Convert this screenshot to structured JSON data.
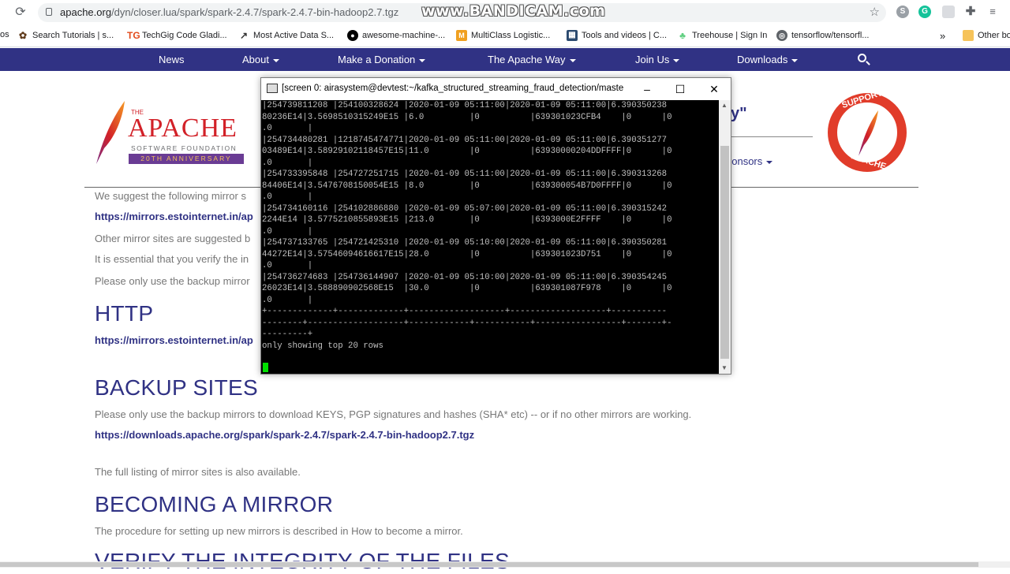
{
  "browser": {
    "url_host": "apache.org",
    "url_path": "/dyn/closer.lua/spark/spark-2.4.7/spark-2.4.7-bin-hadoop2.7.tgz",
    "watermark": "www.BANDICAM.com"
  },
  "bookmarks": {
    "items": [
      {
        "label": "os"
      },
      {
        "label": "Search Tutorials | s..."
      },
      {
        "label": "TechGig Code Gladi..."
      },
      {
        "label": "Most Active Data S..."
      },
      {
        "label": "awesome-machine-..."
      },
      {
        "label": "MultiClass Logistic..."
      },
      {
        "label": "Tools and videos | C..."
      },
      {
        "label": "Treehouse | Sign In"
      },
      {
        "label": "tensorflow/tensorfl..."
      },
      {
        "label": "Other bo"
      }
    ],
    "more": "»"
  },
  "apache_nav": {
    "items": [
      "News",
      "About",
      "Make a Donation",
      "The Apache Way",
      "Join Us",
      "Downloads"
    ]
  },
  "logo": {
    "the": "THE",
    "name": "APACHE",
    "foundation": "SOFTWARE FOUNDATION",
    "anniversary": "20TH ANNIVERSARY",
    "support_top": "SUPPORT",
    "support_bottom": "APACHE"
  },
  "page": {
    "quote_fragment": "y\"",
    "sponsors": "ponsors",
    "suggest": "We suggest the following mirror s",
    "mirror_link": "https://mirrors.estointernet.in/ap",
    "other_mirrors": "Other mirror sites are suggested b",
    "essential": "It is essential that you verify the in",
    "backup_only": "Please only use the backup mirror",
    "http_heading": "HTTP",
    "http_link": "https://mirrors.estointernet.in/ap",
    "backup_heading": "BACKUP SITES",
    "backup_text": "Please only use the backup mirrors to download KEYS, PGP signatures and hashes (SHA* etc) -- or if no other mirrors are working.",
    "backup_link": "https://downloads.apache.org/spark/spark-2.4.7/spark-2.4.7-bin-hadoop2.7.tgz",
    "full_listing_1": "The full listing of mirror sites",
    "full_listing_2": " is also available.",
    "mirror_heading": "BECOMING A MIRROR",
    "mirror_text_1": "The procedure for setting up new mirrors is described in ",
    "mirror_text_2": "How to become a mirror",
    "mirror_text_3": ".",
    "verify_heading": "VERIFY THE INTEGRITY OF THE FILES"
  },
  "terminal": {
    "title": "[screen 0: airasystem@devtest:~/kafka_structured_streaming_fraud_detection/maste",
    "lines": [
      "|254739811208 |254100328624 |2020-01-09 05:11:00|2020-01-09 05:11:00|6.390350238",
      "80236E14|3.5698510315249E15 |6.0         |0          |639301023CFB4    |0      |0",
      ".0       |",
      "|254734480281 |1218745474771|2020-01-09 05:11:00|2020-01-09 05:11:00|6.390351277",
      "03489E14|3.58929102118457E15|11.0        |0          |63930000204DDFFFF|0      |0",
      ".0       |",
      "|254733395848 |254727251715 |2020-01-09 05:11:00|2020-01-09 05:11:00|6.390313268",
      "84406E14|3.5476708150054E15 |8.0         |0          |639300054B7D0FFFF|0      |0",
      ".0       |",
      "|254734160116 |254102886880 |2020-01-09 05:07:00|2020-01-09 05:11:00|6.390315242",
      "2244E14 |3.5775210855893E15 |213.0       |0          |6393000E2FFFF    |0      |0",
      ".0       |",
      "|254737133765 |254721425310 |2020-01-09 05:10:00|2020-01-09 05:11:00|6.390350281",
      "44272E14|3.57546094616617E15|28.0        |0          |639301023D751    |0      |0",
      ".0       |",
      "|254736274683 |254736144907 |2020-01-09 05:10:00|2020-01-09 05:11:00|6.390354245",
      "26023E14|3.588890902568E15  |30.0        |0          |639301087F978    |0      |0",
      ".0       |",
      "+-------------+-------------+-------------------+-------------------+-----------",
      "--------+-------------------+------------+-----------+-----------------+-------+-",
      "---------+",
      "only showing top 20 rows"
    ]
  }
}
